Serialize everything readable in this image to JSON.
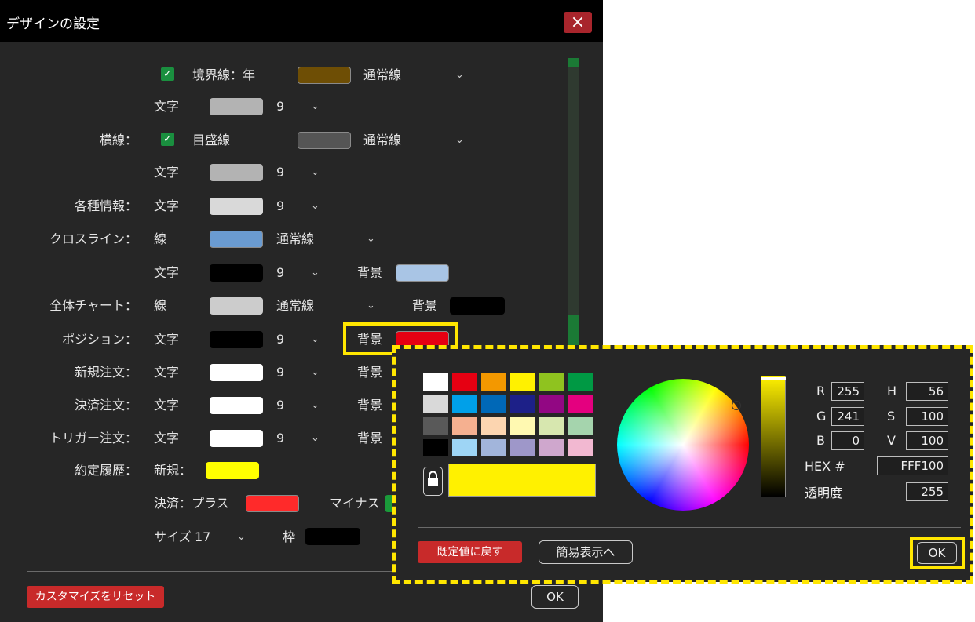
{
  "window": {
    "title": "デザインの設定",
    "close_icon": "×"
  },
  "rows": {
    "year": {
      "check": "✓",
      "label": "境界線：年",
      "style": "通常線",
      "color": "#6e4e05"
    },
    "text1": {
      "label": "文字",
      "size": "9",
      "color": "#b3b3b3"
    },
    "horizontal": {
      "label": "横線：",
      "check": "✓",
      "sub": "目盛線",
      "style": "通常線",
      "color": "#555555"
    },
    "text2": {
      "label": "文字",
      "size": "9",
      "color": "#b3b3b3"
    },
    "info": {
      "label": "各種情報：",
      "sub": "文字",
      "size": "9",
      "color": "#d9d9d9"
    },
    "cross": {
      "label": "クロスライン：",
      "sub": "線",
      "style": "通常線",
      "color": "#6a9bd1"
    },
    "cross_text": {
      "label": "文字",
      "size": "9",
      "bg_label": "背景",
      "color": "#000000",
      "bg_color": "#a9c5e5"
    },
    "overall": {
      "label": "全体チャート：",
      "sub": "線",
      "style": "通常線",
      "bg_label": "背景",
      "color": "#cccccc",
      "bg_color": "#000000"
    },
    "position": {
      "label": "ポジション：",
      "sub": "文字",
      "size": "9",
      "bg_label": "背景",
      "color": "#000000",
      "bg_color": "#e60012"
    },
    "new_order": {
      "label": "新規注文：",
      "sub": "文字",
      "size": "9",
      "bg_label": "背景",
      "color": "#ffffff"
    },
    "settle_order": {
      "label": "決済注文：",
      "sub": "文字",
      "size": "9",
      "bg_label": "背景",
      "color": "#ffffff"
    },
    "trigger_order": {
      "label": "トリガー注文：",
      "sub": "文字",
      "size": "9",
      "bg_label": "背景",
      "color": "#ffffff"
    },
    "history": {
      "label": "約定履歴：",
      "sub": "新規：",
      "color": "#ffff00"
    },
    "settle": {
      "label": "決済：プラス",
      "minus_label": "マイナス",
      "plus_color": "#ff2a2a",
      "minus_color": "#1a9a3a"
    },
    "size": {
      "label": "サイズ",
      "value": "17",
      "frame_label": "枠",
      "frame_color": "#000000"
    }
  },
  "footer": {
    "reset_label": "カスタマイズをリセット",
    "ok_label": "OK"
  },
  "picker": {
    "palette": [
      [
        "#ffffff",
        "#e60012",
        "#f39800",
        "#fff100",
        "#8fc31f",
        "#009944"
      ],
      [
        "#d9d9d9",
        "#00a0e9",
        "#0068b7",
        "#1d2088",
        "#920783",
        "#e4007f"
      ],
      [
        "#595959",
        "#f5b090",
        "#fcd5b0",
        "#fff9b1",
        "#d7e7af",
        "#a5d4ad"
      ],
      [
        "#000000",
        "#9ed5f5",
        "#a2b5db",
        "#9e97c9",
        "#cfa7cd",
        "#f2b8d1"
      ]
    ],
    "current_color": "#fff100",
    "lock_icon": "lock-icon",
    "r_label": "R",
    "r": "255",
    "g_label": "G",
    "g": "241",
    "b_label": "B",
    "b": "0",
    "h_label": "H",
    "h": "56",
    "s_label": "S",
    "s": "100",
    "v_label": "V",
    "v": "100",
    "hex_label": "HEX #",
    "hex": "FFF100",
    "alpha_label": "透明度",
    "alpha": "255",
    "default_label": "既定値に戻す",
    "simple_label": "簡易表示へ",
    "ok_label": "OK"
  }
}
